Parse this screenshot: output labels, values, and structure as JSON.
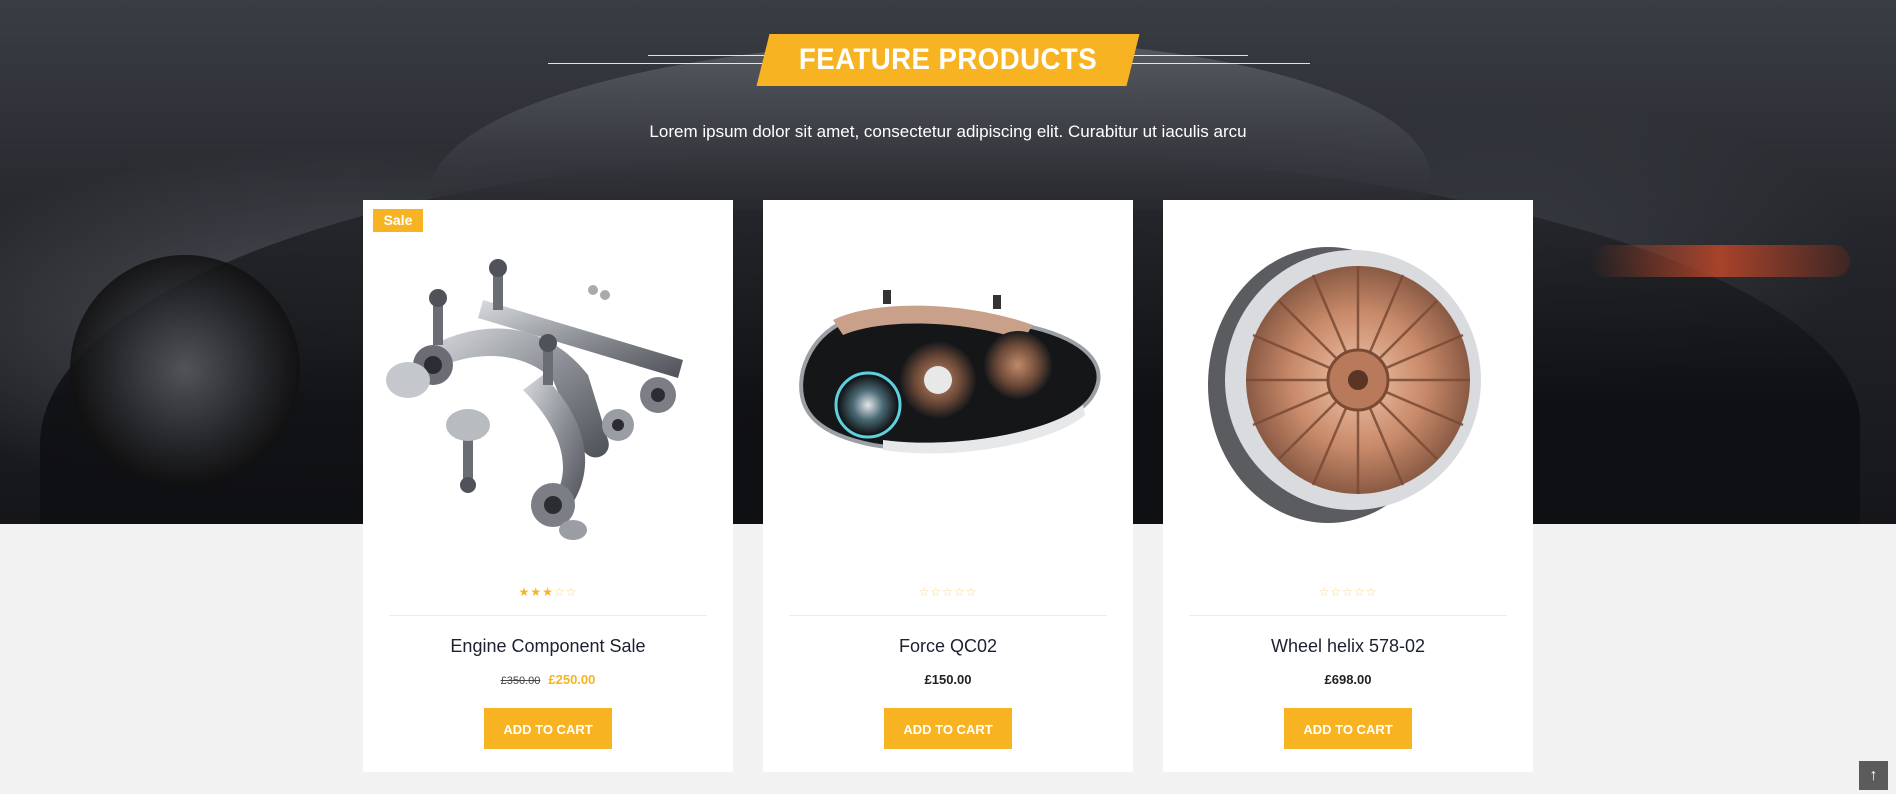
{
  "section": {
    "title": "FEATURE PRODUCTS",
    "subtitle": "Lorem ipsum dolor sit amet, consectetur adipiscing elit. Curabitur ut iaculis arcu"
  },
  "products": [
    {
      "name": "Engine Component Sale",
      "badge": "Sale",
      "rating": 3,
      "rating_max": 5,
      "old_price": "£350.00",
      "price": "£250.00",
      "button_label": "ADD TO CART",
      "image": "suspension-parts-image"
    },
    {
      "name": "Force QC02",
      "rating": 0,
      "rating_max": 5,
      "price": "£150.00",
      "button_label": "ADD TO CART",
      "image": "headlight-image"
    },
    {
      "name": "Wheel helix 578-02",
      "rating": 0,
      "rating_max": 5,
      "price": "£698.00",
      "button_label": "ADD TO CART",
      "image": "wheel-rim-image"
    }
  ],
  "back_to_top_icon": "arrow-up-icon",
  "colors": {
    "accent": "#f7b321",
    "text_dark": "#1c2030",
    "page_bg": "#f2f2f2"
  }
}
